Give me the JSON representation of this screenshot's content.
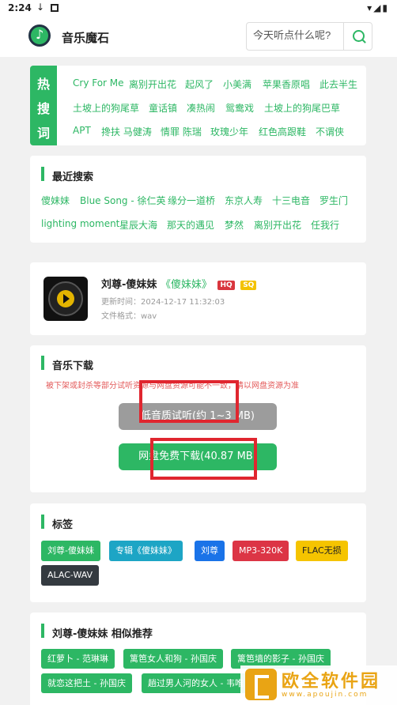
{
  "statusbar": {
    "time": "2:24",
    "download_icon": "↓"
  },
  "header": {
    "app_title": "音乐魔石",
    "search_placeholder": "今天听点什么呢?"
  },
  "hot": {
    "label_chars": [
      "热",
      "搜",
      "词"
    ],
    "rows": [
      [
        "Cry For Me",
        "离别开出花",
        "起风了",
        "小美满",
        "苹果香原唱",
        "此去半生"
      ],
      [
        "土坡上的狗尾草",
        "童话镇",
        "凑热闹",
        "鸳鸯戏",
        "土坡上的狗尾巴草"
      ],
      [
        "APT",
        "搀扶 马健涛",
        "情罪 陈瑞",
        "玫瑰少年",
        "红色高跟鞋",
        "不谓侠"
      ]
    ]
  },
  "recent": {
    "title": "最近搜索",
    "rows": [
      [
        "傻妹妹",
        "Blue Song - 徐仁英",
        "缘分一道桥",
        "东京人寿",
        "十三电音",
        "罗生门"
      ],
      [
        "lighting moment",
        "星辰大海",
        "那天的遇见",
        "梦然",
        "离别开出花",
        "任我行"
      ]
    ]
  },
  "song": {
    "title": "刘尊-傻妹妹",
    "album": "《傻妹妹》",
    "badge_hq": "HQ",
    "badge_sq": "SQ",
    "update_time": "更新时间：2024-12-17 11:32:03",
    "format": "文件格式：wav"
  },
  "download": {
    "title": "音乐下载",
    "warning": "被下架或封杀等部分试听资源与网盘资源可能不一致，请以网盘资源为准",
    "preview_button": "低音质试听(约 1~3 MB)",
    "download_button": "网盘免费下载(40.87 MB)"
  },
  "tags": {
    "title": "标签",
    "items": [
      {
        "label": "刘尊-傻妹妹",
        "color": "#2db764"
      },
      {
        "label": "专辑《傻妹妹》",
        "color": "#1da5c5"
      },
      {
        "label": "刘尊",
        "color": "#1a73e8"
      },
      {
        "label": "MP3-320K",
        "color": "#dc3545"
      },
      {
        "label": "FLAC无损",
        "color": "#f5c400"
      },
      {
        "label": "ALAC-WAV",
        "color": "#343a40"
      }
    ]
  },
  "similar": {
    "title": "刘尊-傻妹妹 相似推荐",
    "items": [
      "红萝卜 - 范琳琳",
      "篱笆女人和狗 - 孙国庆",
      "篱笆墙的影子 - 孙国庆",
      "就恋这把土 - 孙国庆",
      "趟过男人河的女人 - 韦唯"
    ]
  },
  "watermark": {
    "text": "欧全软件园",
    "url": "www.apoujin.com"
  }
}
